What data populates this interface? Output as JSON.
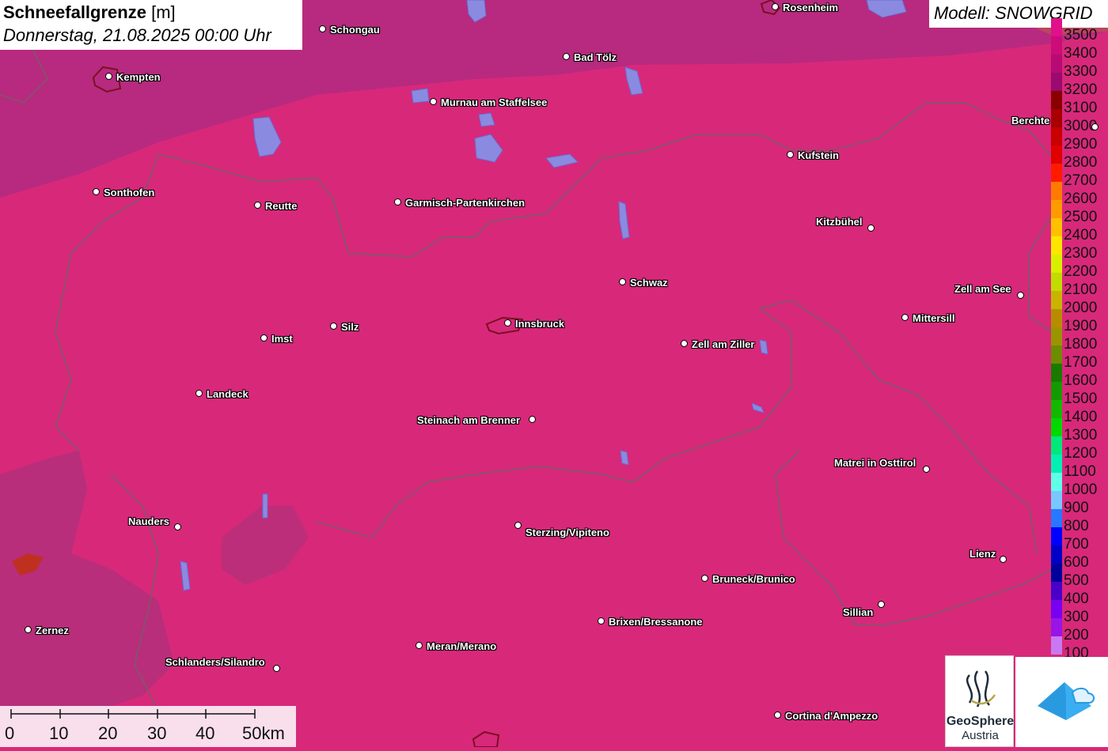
{
  "title": {
    "main": "Schneefallgrenze",
    "unit": "[m]",
    "date": "Donnerstag, 21.08.2025 00:00 Uhr"
  },
  "model": "Modell: SNOWGRID",
  "legend": [
    {
      "label": "3500",
      "color": "#e0108a"
    },
    {
      "label": "3400",
      "color": "#cc0c78"
    },
    {
      "label": "3300",
      "color": "#b80a74"
    },
    {
      "label": "3200",
      "color": "#9a0a70"
    },
    {
      "label": "3100",
      "color": "#8a0000"
    },
    {
      "label": "3000",
      "color": "#a80000"
    },
    {
      "label": "2900",
      "color": "#c80000"
    },
    {
      "label": "2800",
      "color": "#e00000"
    },
    {
      "label": "2700",
      "color": "#ff1a00"
    },
    {
      "label": "2600",
      "color": "#ff7a00"
    },
    {
      "label": "2500",
      "color": "#ff9a00"
    },
    {
      "label": "2400",
      "color": "#ffc000"
    },
    {
      "label": "2300",
      "color": "#ffe600"
    },
    {
      "label": "2200",
      "color": "#d8f000"
    },
    {
      "label": "2100",
      "color": "#c0dc00"
    },
    {
      "label": "2000",
      "color": "#c8b400"
    },
    {
      "label": "1900",
      "color": "#b88c00"
    },
    {
      "label": "1800",
      "color": "#9a9400"
    },
    {
      "label": "1700",
      "color": "#6e8c00"
    },
    {
      "label": "1600",
      "color": "#1a7a00"
    },
    {
      "label": "1500",
      "color": "#149a00"
    },
    {
      "label": "1400",
      "color": "#14b800"
    },
    {
      "label": "1300",
      "color": "#00d800"
    },
    {
      "label": "1200",
      "color": "#00e87a"
    },
    {
      "label": "1100",
      "color": "#00f0b4"
    },
    {
      "label": "1000",
      "color": "#60ffe8"
    },
    {
      "label": "900",
      "color": "#78c8ff"
    },
    {
      "label": "800",
      "color": "#2878ff"
    },
    {
      "label": "700",
      "color": "#0000ff"
    },
    {
      "label": "600",
      "color": "#0000c8"
    },
    {
      "label": "500",
      "color": "#00009a"
    },
    {
      "label": "400",
      "color": "#4a00c8"
    },
    {
      "label": "300",
      "color": "#7a00f0"
    },
    {
      "label": "200",
      "color": "#9a14e6"
    },
    {
      "label": "100",
      "color": "#c878f0"
    }
  ],
  "scalebar": {
    "labels": [
      "0",
      "10",
      "20",
      "30",
      "40",
      "50km"
    ]
  },
  "logo": {
    "name": "GeoSphere",
    "sub": "Austria"
  },
  "cities": [
    {
      "name": "Schongau"
    },
    {
      "name": "Rosenheim"
    },
    {
      "name": "Kempten"
    },
    {
      "name": "Bad Tölz"
    },
    {
      "name": "Murnau am Staffelsee"
    },
    {
      "name": "Berchte"
    },
    {
      "name": "Kufstein"
    },
    {
      "name": "Sonthofen"
    },
    {
      "name": "Reutte"
    },
    {
      "name": "Garmisch-Partenkirchen"
    },
    {
      "name": "Kitzbühel"
    },
    {
      "name": "Schwaz"
    },
    {
      "name": "Zell am See"
    },
    {
      "name": "Mittersill"
    },
    {
      "name": "Innsbruck"
    },
    {
      "name": "Silz"
    },
    {
      "name": "Imst"
    },
    {
      "name": "Zell am Ziller"
    },
    {
      "name": "Landeck"
    },
    {
      "name": "Steinach am Brenner"
    },
    {
      "name": "Matrei in Osttirol"
    },
    {
      "name": "Nauders"
    },
    {
      "name": "Sterzing/Vipiteno"
    },
    {
      "name": "Lienz"
    },
    {
      "name": "Bruneck/Brunico"
    },
    {
      "name": "Sillian"
    },
    {
      "name": "Zernez"
    },
    {
      "name": "Brixen/Bressanone"
    },
    {
      "name": "Meran/Merano"
    },
    {
      "name": "Schlanders/Silandro"
    },
    {
      "name": "Cortina d'Ampezzo"
    }
  ],
  "colors": {
    "main_fill": "#d8287a",
    "north_fill": "#b22a80",
    "west_fill": "#b0307a",
    "border": "#7a5a6a",
    "lake": "#8a8ae0"
  }
}
